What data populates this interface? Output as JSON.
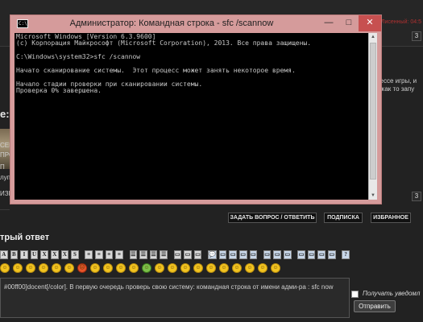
{
  "cmd": {
    "title": "Администратор: Командная строка - sfc  /scannow",
    "icon_label": "C:\\",
    "minimize_glyph": "—",
    "maximize_glyph": "□",
    "close_glyph": "✕",
    "lines": [
      "Microsoft Windows [Version 6.3.9600]",
      "(c) Корпорация Майкрософт (Microsoft Corporation), 2013. Все права защищены.",
      "",
      "C:\\Windows\\system32>sfc /scannow",
      "",
      "Начато сканирование системы.  Этот процесс может занять некоторое время.",
      "",
      "Начало стадии проверки при сканировании системы.",
      "Проверка 0% завершена."
    ],
    "scroll_up_glyph": "▲",
    "scroll_down_glyph": "▼"
  },
  "forum": {
    "top_right_red": "Лисенный: 04:5",
    "box_label": "3",
    "right_snippets": [
      "цессе игры, и",
      "е как то запу"
    ],
    "left_snippets": [
      "СЕЙ",
      "ПРС",
      "П",
      "лупл",
      "ИЗНС"
    ],
    "title_fragment": "e: Г",
    "actions": {
      "ask": "ЗАДАТЬ ВОПРОС / ОТВЕТИТЬ",
      "subscribe": "ПОДПИСКА",
      "favorite": "ИЗБРАННОЕ"
    },
    "reply_title": "трый ответ",
    "reply_text": "#00ff00]docent[/color]. В первую очередь проверь свою систему: командная строка от имени адми-ра : sfc now",
    "notify_label": "Получать уведомл",
    "send_label": "Отправить",
    "toolbar_glyphs": [
      "A",
      "B",
      "I",
      "U",
      "X",
      "X",
      "X",
      "S",
      "",
      "≡",
      "≡",
      "≡",
      "≡",
      "",
      "☰",
      "☰",
      "☰",
      "☰",
      "",
      "▭",
      "▭",
      "▭",
      "",
      "💬",
      "▭",
      "▭",
      "▭",
      "▭",
      "",
      "▭",
      "▭",
      "▭",
      "",
      "▭",
      "▭",
      "▭",
      "▭",
      "",
      "?"
    ],
    "smileys": [
      "☺",
      "☺",
      "☺",
      "☺",
      "☺",
      "☺",
      "☹",
      "☺",
      "☺",
      "☺",
      "☺",
      "☺",
      "☺",
      "☺",
      "☺",
      "☺",
      "☺",
      "☺",
      "☺",
      "☺",
      "☺",
      "☺"
    ]
  }
}
